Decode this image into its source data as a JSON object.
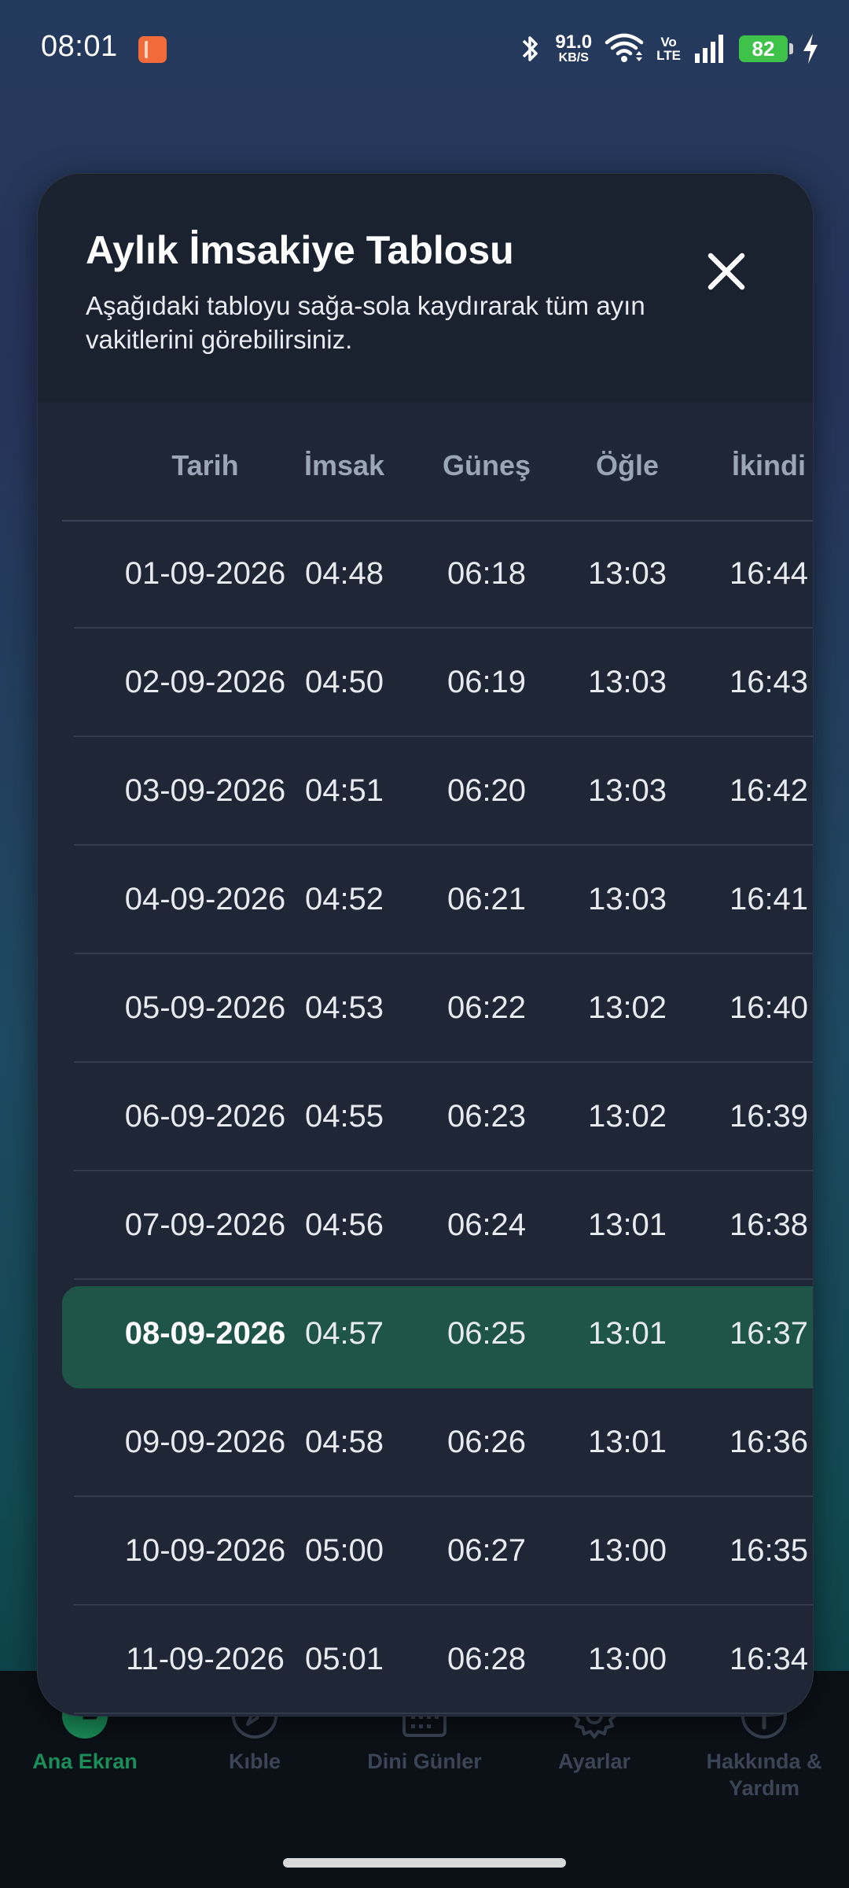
{
  "status_bar": {
    "time": "08:01",
    "net_speed_value": "91.0",
    "net_speed_unit": "KB/S",
    "volte_top": "Vo",
    "volte_bottom": "LTE",
    "battery": "82"
  },
  "modal": {
    "title": "Aylık İmsakiye Tablosu",
    "subtitle": "Aşağıdaki tabloyu sağa-sola kaydırarak tüm ayın vakitlerini görebilirsiniz.",
    "close_icon": "close-icon"
  },
  "table": {
    "headers": [
      "Tarih",
      "İmsak",
      "Güneş",
      "Öğle",
      "İkindi"
    ],
    "rows": [
      [
        "01-09-2026",
        "04:48",
        "06:18",
        "13:03",
        "16:44"
      ],
      [
        "02-09-2026",
        "04:50",
        "06:19",
        "13:03",
        "16:43"
      ],
      [
        "03-09-2026",
        "04:51",
        "06:20",
        "13:03",
        "16:42"
      ],
      [
        "04-09-2026",
        "04:52",
        "06:21",
        "13:03",
        "16:41"
      ],
      [
        "05-09-2026",
        "04:53",
        "06:22",
        "13:02",
        "16:40"
      ],
      [
        "06-09-2026",
        "04:55",
        "06:23",
        "13:02",
        "16:39"
      ],
      [
        "07-09-2026",
        "04:56",
        "06:24",
        "13:01",
        "16:38"
      ],
      [
        "08-09-2026",
        "04:57",
        "06:25",
        "13:01",
        "16:37"
      ],
      [
        "09-09-2026",
        "04:58",
        "06:26",
        "13:01",
        "16:36"
      ],
      [
        "10-09-2026",
        "05:00",
        "06:27",
        "13:00",
        "16:35"
      ],
      [
        "11-09-2026",
        "05:01",
        "06:28",
        "13:00",
        "16:34"
      ]
    ],
    "highlighted_row": 7,
    "highlight_color": "#1f5448"
  },
  "bottom_nav": {
    "items": [
      {
        "label": "Ana Ekran",
        "icon": "clock-icon",
        "active": true
      },
      {
        "label": "Kıble",
        "icon": "compass-icon",
        "active": false
      },
      {
        "label": "Dini Günler",
        "icon": "calendar-icon",
        "active": false
      },
      {
        "label": "Ayarlar",
        "icon": "gear-icon",
        "active": false
      },
      {
        "label": "Hakkında & Yardım",
        "icon": "info-icon",
        "active": false
      }
    ],
    "active_color": "#1a8f5a"
  }
}
